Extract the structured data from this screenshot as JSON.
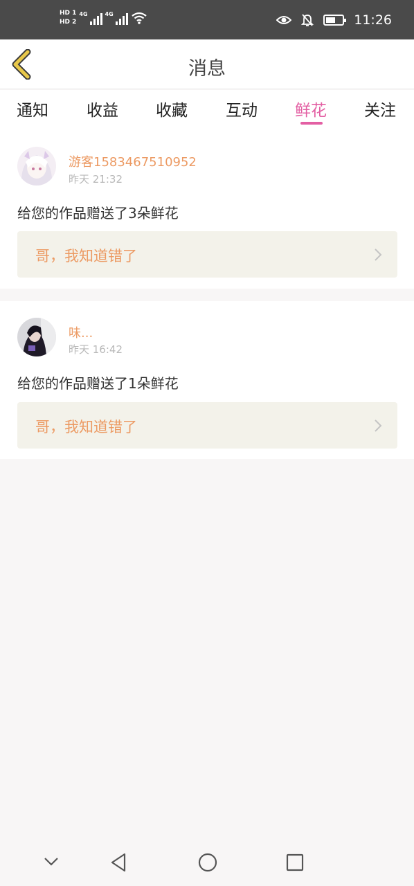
{
  "status_bar": {
    "sim1_label": "HD 1",
    "sim2_label": "HD 2",
    "network1": "4G",
    "network2": "4G",
    "time": "11:26",
    "icons": [
      "eye-icon",
      "bell-off-icon",
      "battery-icon",
      "wifi-icon"
    ]
  },
  "header": {
    "title": "消息",
    "back_icon": "chevron-left-icon"
  },
  "tabs": [
    {
      "label": "通知"
    },
    {
      "label": "收益"
    },
    {
      "label": "收藏"
    },
    {
      "label": "互动"
    },
    {
      "label": "鲜花",
      "active": true
    },
    {
      "label": "关注"
    }
  ],
  "messages": [
    {
      "username": "游客1583467510952",
      "time": "昨天 21:32",
      "text": "给您的作品赠送了3朵鲜花",
      "work_title": "哥，我知道错了"
    },
    {
      "username": "味...",
      "time": "昨天 16:42",
      "text": "给您的作品赠送了1朵鲜花",
      "work_title": "哥，我知道错了"
    }
  ],
  "nav_bar": {
    "icons": [
      "nav-collapse-icon",
      "nav-back-icon",
      "nav-home-icon",
      "nav-recents-icon"
    ]
  },
  "colors": {
    "accent": "#e35fa3",
    "username": "#ec9a63",
    "back_icon": "#e8c84a",
    "work_box_bg": "#f3f2ea"
  }
}
